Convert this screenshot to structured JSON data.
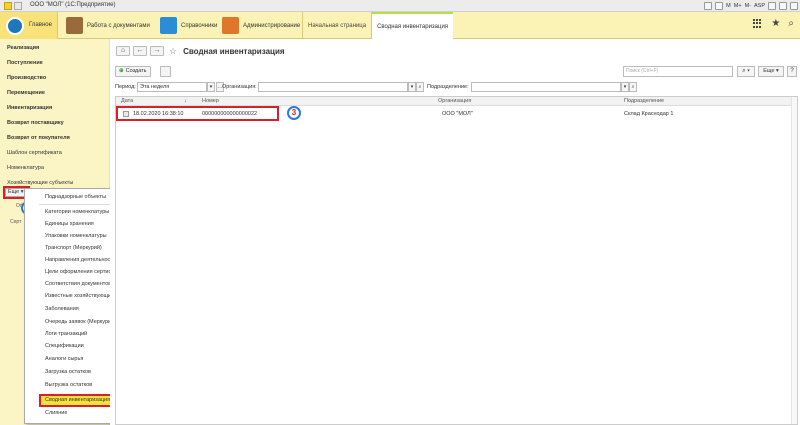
{
  "window": {
    "title": "ООО \"МОЛ\" (1С:Предприятие)",
    "toolbar_items": [
      "M",
      "M+",
      "M-",
      "ASP"
    ]
  },
  "sections": {
    "main": "Главное",
    "docs": "Работа с документами",
    "refs": "Справочники",
    "admin": "Администрирование",
    "tabs": [
      "Начальная страница",
      "Сводная инвентаризация"
    ]
  },
  "leftnav": {
    "items": [
      {
        "label": "Реализация",
        "bold": true
      },
      {
        "label": "Поступление",
        "bold": true
      },
      {
        "label": "Производство",
        "bold": true
      },
      {
        "label": "Перемещение",
        "bold": true
      },
      {
        "label": "Инвентаризация",
        "bold": true
      },
      {
        "label": "Возврат поставщику",
        "bold": true
      },
      {
        "label": "Возврат от покупателя",
        "bold": true
      },
      {
        "label": "Шаблон сертификата",
        "bold": false
      },
      {
        "label": "Номенклатура",
        "bold": false
      },
      {
        "label": "Хозяйствующие субъекты",
        "bold": false
      }
    ],
    "more_label": "Еще",
    "stub_labels": [
      "Оф",
      "Серт"
    ]
  },
  "menu": {
    "header": "Поднадзорные объекты",
    "items": [
      "Категории номенклатуры",
      "Единицы хранения",
      "Упаковки номенклатуры",
      "Транспорт (Меркурий)",
      "Направления деятельности",
      "Цели оформления сертификата",
      "Соответствия документов",
      "Известные хозяйствующие",
      "Заболевания",
      "Очередь заявок (Меркурий)",
      "Логи транзакций",
      "Спецификации",
      "Аналоги сырья",
      "Загрузка остатков",
      "Выгрузка остатков",
      "Сводная инвентаризация",
      "Слияние"
    ],
    "highlighted": "Сводная инвентаризация"
  },
  "form": {
    "title": "Сводная инвентаризация",
    "create_label": "Создать",
    "search_placeholder": "Поиск (Ctrl+F)",
    "more_label": "Еще",
    "help_label": "?",
    "filters": {
      "period_label": "Период:",
      "period_value": "Эта неделя",
      "org_label": "Организация:",
      "org_value": "",
      "dept_label": "Подразделение:",
      "dept_value": ""
    },
    "columns": [
      "Дата",
      "Номер",
      "Организация",
      "Подразделение"
    ],
    "rows": [
      {
        "date": "18.02.2020 16:38:10",
        "number": "000000000000000022",
        "org": "ООО \"МОЛ\"",
        "dept": "Склад Краснодар 1"
      }
    ]
  },
  "markers": [
    "1",
    "2",
    "3"
  ],
  "colors": {
    "section_bg": "#fbf3b5",
    "highlight": "#f7e13b",
    "marker_border": "#2a7bd4",
    "red_frame": "#d9202a"
  }
}
